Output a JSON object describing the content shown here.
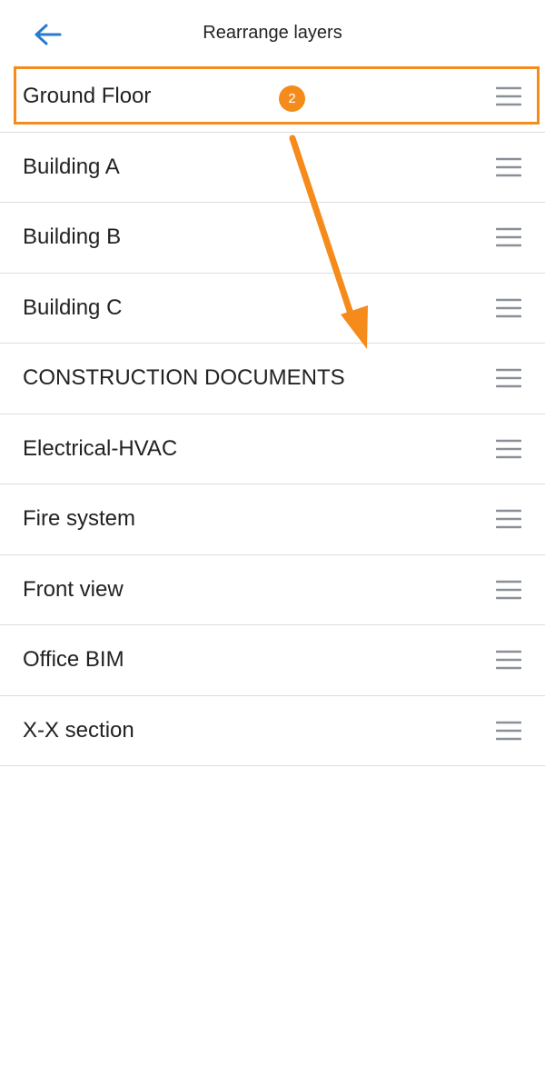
{
  "header": {
    "title": "Rearrange layers",
    "back_icon": "arrow-left-icon"
  },
  "layers": [
    {
      "label": "Ground Floor"
    },
    {
      "label": "Building A"
    },
    {
      "label": "Building B"
    },
    {
      "label": "Building C"
    },
    {
      "label": "CONSTRUCTION DOCUMENTS"
    },
    {
      "label": "Electrical-HVAC"
    },
    {
      "label": "Fire system"
    },
    {
      "label": "Front view"
    },
    {
      "label": "Office BIM"
    },
    {
      "label": "X-X section"
    }
  ],
  "annotation": {
    "step_number": "2",
    "color": "#f48b1b"
  },
  "colors": {
    "accent": "#2a7ad0",
    "handle": "#8a8f98",
    "divider": "#dcdcdc"
  }
}
